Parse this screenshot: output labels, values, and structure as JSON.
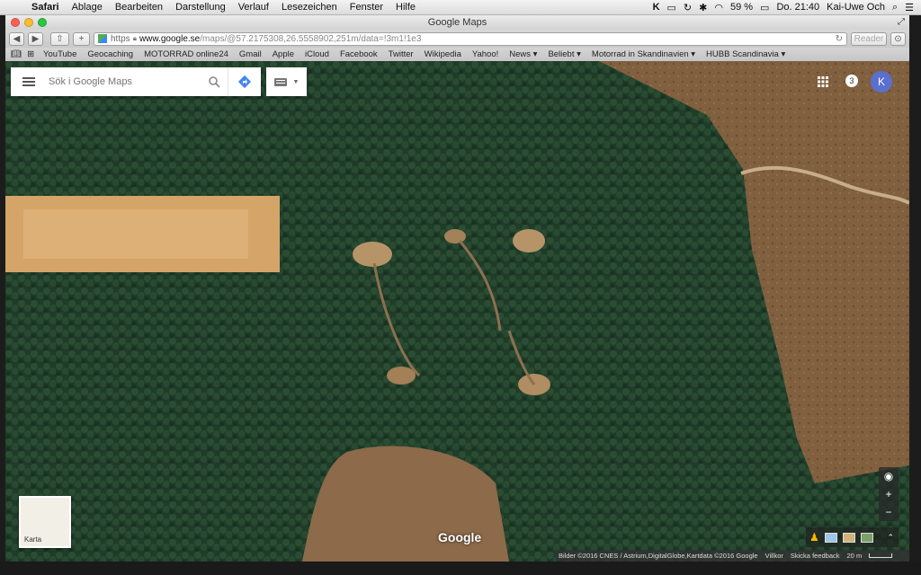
{
  "menubar": {
    "app": "Safari",
    "items": [
      "Ablage",
      "Bearbeiten",
      "Darstellung",
      "Verlauf",
      "Lesezeichen",
      "Fenster",
      "Hilfe"
    ],
    "battery": "59 %",
    "clock": "Do. 21:40",
    "user": "Kai-Uwe Och"
  },
  "window": {
    "title": "Google Maps"
  },
  "toolbar": {
    "url_scheme": "https",
    "url_domain": "www.google.se",
    "url_path": "/maps/@57.2175308,26.5558902,251m/data=!3m1!1e3",
    "reader_label": "Reader"
  },
  "bookmarks": [
    "YouTube",
    "Geocaching",
    "MOTORRAD online24",
    "Gmail",
    "Apple",
    "iCloud",
    "Facebook",
    "Twitter",
    "Wikipedia",
    "Yahoo!",
    "News ▾",
    "Beliebt ▾",
    "Motorrad in Skandinavien ▾",
    "HUBB Scandinavia ▾"
  ],
  "maps": {
    "search_placeholder": "Sök i Google Maps",
    "notification_count": "3",
    "avatar_letter": "K",
    "karta_label": "Karta",
    "google_logo": "Google",
    "attribution": "Bilder ©2016 CNES / Astrium,DigitalGlobe,Kartdata ©2016 Google",
    "terms": "Villkor",
    "feedback": "Skicka feedback",
    "scale": "20 m"
  },
  "colors": {
    "forest": "#21402a",
    "clearing": "#d9a667",
    "field": "#7d5a3c",
    "avatar": "#5b6fd0"
  }
}
